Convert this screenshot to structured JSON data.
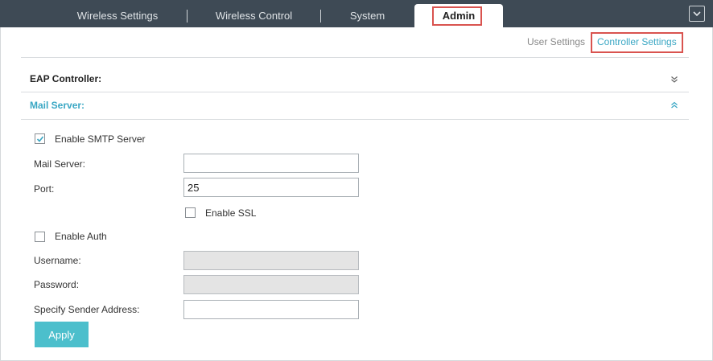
{
  "nav": {
    "tabs": [
      {
        "label": "Wireless Settings"
      },
      {
        "label": "Wireless Control"
      },
      {
        "label": "System"
      },
      {
        "label": "Admin"
      }
    ],
    "active_tab": "Admin"
  },
  "subnav": {
    "items": [
      {
        "label": "User Settings"
      },
      {
        "label": "Controller Settings"
      }
    ],
    "active": "Controller Settings"
  },
  "sections": {
    "eap_controller": {
      "title": "EAP Controller:"
    },
    "mail_server": {
      "title": "Mail Server:"
    }
  },
  "form": {
    "enable_smtp": {
      "label": "Enable SMTP Server",
      "checked": true
    },
    "mail_server": {
      "label": "Mail Server:",
      "value": ""
    },
    "port": {
      "label": "Port:",
      "value": "25"
    },
    "enable_ssl": {
      "label": "Enable SSL",
      "checked": false
    },
    "enable_auth": {
      "label": "Enable Auth",
      "checked": false
    },
    "username": {
      "label": "Username:",
      "value": ""
    },
    "password": {
      "label": "Password:",
      "value": ""
    },
    "sender_address": {
      "label": "Specify Sender Address:",
      "value": ""
    },
    "apply_label": "Apply"
  },
  "colors": {
    "topbar": "#3e4a55",
    "accent": "#3aa7c4",
    "button": "#4cbfcc",
    "highlight": "#d9534f"
  },
  "icons": {
    "corner": "chevron-down-icon",
    "eap_toggle": "double-chevron-down-icon",
    "mail_toggle": "double-chevron-up-icon",
    "check": "checkmark-icon"
  }
}
